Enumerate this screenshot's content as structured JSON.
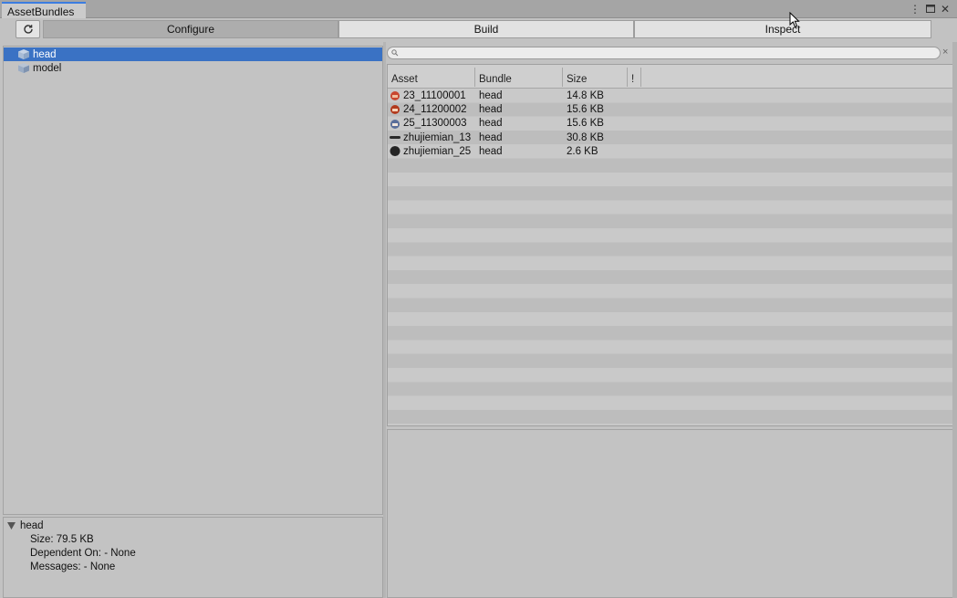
{
  "window": {
    "tab_title": "AssetBundles"
  },
  "toolbar": {
    "refresh_icon": "refresh-icon",
    "modes": [
      {
        "label": "Configure",
        "active": true
      },
      {
        "label": "Build",
        "active": false
      },
      {
        "label": "Inspect",
        "active": false
      }
    ]
  },
  "bundles": [
    {
      "label": "head",
      "selected": true
    },
    {
      "label": "model",
      "selected": false
    }
  ],
  "search": {
    "placeholder": ""
  },
  "asset_table": {
    "columns": [
      "Asset",
      "Bundle",
      "Size",
      "!"
    ],
    "rows": [
      {
        "asset": "23_11100001",
        "bundle": "head",
        "size": "14.8 KB"
      },
      {
        "asset": "24_11200002",
        "bundle": "head",
        "size": "15.6 KB"
      },
      {
        "asset": "25_11300003",
        "bundle": "head",
        "size": "15.6 KB"
      },
      {
        "asset": "zhujiemian_13",
        "bundle": "head",
        "size": "30.8 KB"
      },
      {
        "asset": "zhujiemian_25",
        "bundle": "head",
        "size": "2.6 KB"
      }
    ]
  },
  "details": {
    "title": "head",
    "size": "Size: 79.5 KB",
    "dependent": "Dependent On: - None",
    "messages": "Messages: - None"
  },
  "colors": {
    "selection": "#3a72c4",
    "tab_accent": "#3c7de0"
  }
}
